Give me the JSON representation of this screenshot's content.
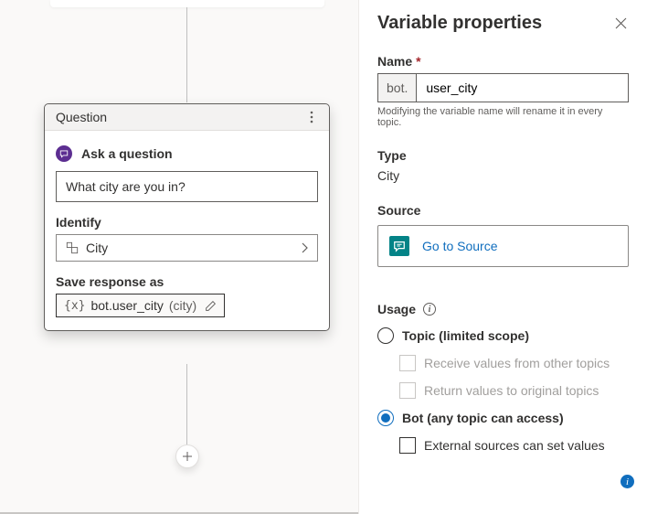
{
  "card": {
    "header": "Question",
    "section": "Ask a question",
    "question_value": "What city are you in?",
    "identify_label": "Identify",
    "identify_value": "City",
    "save_label": "Save response as",
    "chip_var": "bot.user_city",
    "chip_type": "(city)"
  },
  "panel": {
    "title": "Variable properties",
    "name_label": "Name",
    "name_prefix": "bot.",
    "name_value": "user_city",
    "name_hint": "Modifying the variable name will rename it in every topic.",
    "type_label": "Type",
    "type_value": "City",
    "source_label": "Source",
    "source_button": "Go to Source",
    "usage_label": "Usage",
    "scope_topic": "Topic (limited scope)",
    "receive": "Receive values from other topics",
    "return": "Return values to original topics",
    "scope_bot": "Bot (any topic can access)",
    "external": "External sources can set values"
  }
}
